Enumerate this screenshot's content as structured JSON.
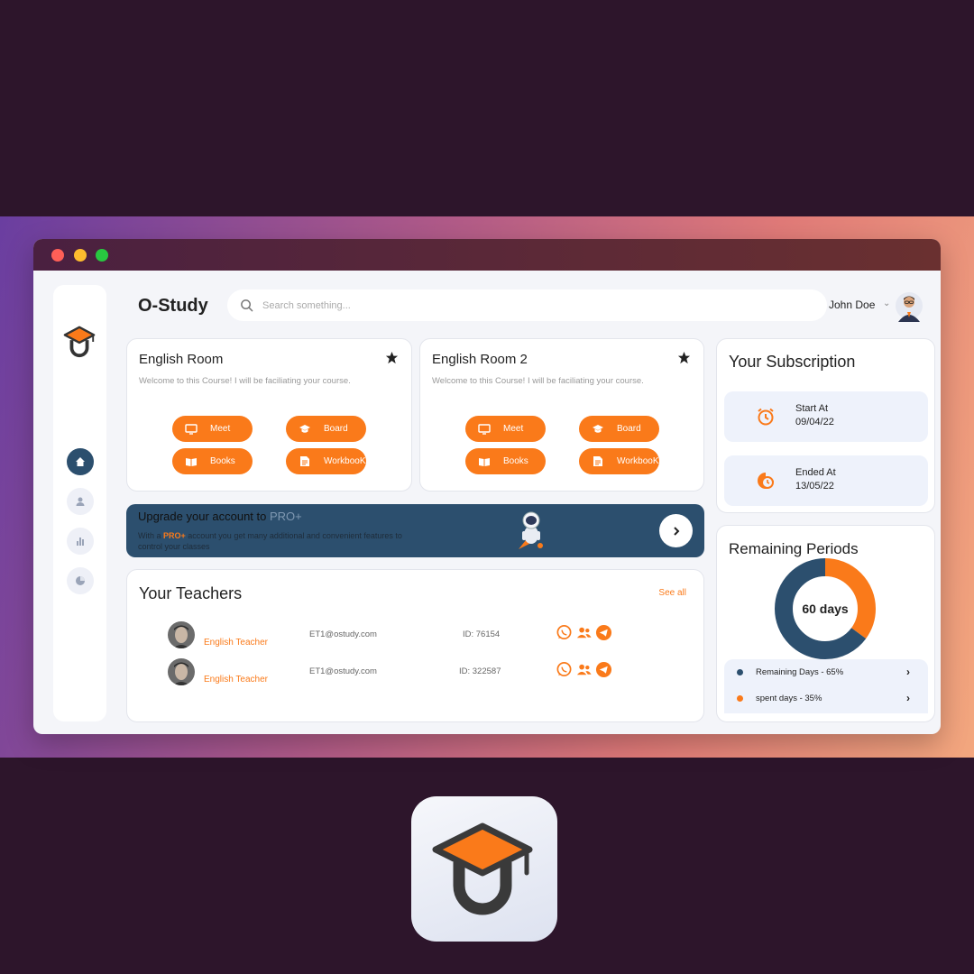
{
  "app": {
    "brand": "O-Study"
  },
  "search": {
    "placeholder": "Search something..."
  },
  "user": {
    "name": "John Doe"
  },
  "colors": {
    "accent": "#fa7a1a",
    "navy": "#2c4f6e",
    "background": "#2d152b"
  },
  "sidebar": {
    "logo_icon": "graduation-cap-logo",
    "items": [
      {
        "icon": "home-icon",
        "active": true
      },
      {
        "icon": "user-icon",
        "active": false
      },
      {
        "icon": "bar-chart-icon",
        "active": false
      },
      {
        "icon": "pie-chart-icon",
        "active": false
      }
    ]
  },
  "rooms": [
    {
      "title": "English Room",
      "description": "Welcome to this Course! I will be faciliating your course.",
      "buttons": {
        "meet": "Meet",
        "board": "Board",
        "books": "Books",
        "workbook": "WorkbooK"
      }
    },
    {
      "title": "English Room 2",
      "description": "Welcome to this Course! I will be faciliating your course.",
      "buttons": {
        "meet": "Meet",
        "board": "Board",
        "books": "Books",
        "workbook": "WorkbooK"
      }
    }
  ],
  "upgrade": {
    "title_prefix": "Upgrade your account to ",
    "title_pro": "PRO+",
    "text_prefix": "With a ",
    "text_pro": "PRO+",
    "text_suffix": " account you get many additional and convenient features to control your classes"
  },
  "teachers": {
    "title": "Your Teachers",
    "see_all": "See all",
    "rows": [
      {
        "role": "English Teacher",
        "email": "ET1@ostudy.com",
        "id": "ID: 76154"
      },
      {
        "role": "English Teacher",
        "email": "ET1@ostudy.com",
        "id": "ID: 322587"
      }
    ]
  },
  "subscription": {
    "title": "Your Subscription",
    "start_label": "Start At",
    "start_date": "09/04/22",
    "end_label": "Ended At",
    "end_date": "13/05/22"
  },
  "remaining": {
    "title": "Remaining Periods",
    "center_label": "60 days",
    "legend": [
      {
        "label": "Remaining Days - 65%",
        "color": "#2c4f6e"
      },
      {
        "label": "spent days - 35%",
        "color": "#fa7a1a"
      }
    ]
  },
  "chart_data": {
    "type": "pie",
    "categories": [
      "Remaining Days",
      "spent days"
    ],
    "values": [
      65,
      35
    ],
    "center_label": "60 days"
  }
}
